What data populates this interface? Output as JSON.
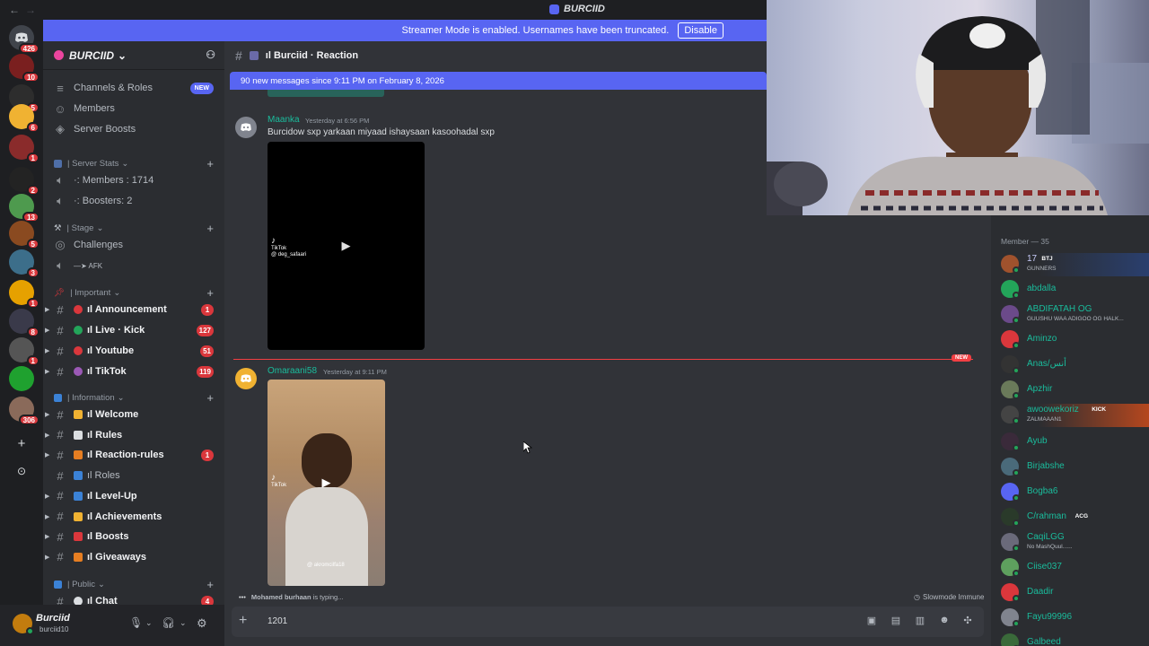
{
  "titlebar": {
    "title": "BURCIID",
    "back": "←",
    "forward": "→"
  },
  "banner": {
    "text": "Streamer Mode is enabled. Usernames have been truncated.",
    "button": "Disable"
  },
  "servers": [
    {
      "badge": "426",
      "color": "#40444b"
    },
    {
      "badge": "10",
      "color": "#7a1f1f"
    },
    {
      "badge": "5",
      "color": "#2d2d2d"
    },
    {
      "badge": "6",
      "color": "#f0b232"
    },
    {
      "badge": "1",
      "color": "#8a2b2b"
    },
    {
      "badge": "2",
      "color": "#232323"
    },
    {
      "badge": "13",
      "color": "#4e9a4e"
    },
    {
      "badge": "5",
      "color": "#8a4a20"
    },
    {
      "badge": "3",
      "color": "#3c6e8a"
    },
    {
      "badge": "1",
      "color": "#e6a100"
    },
    {
      "badge": "8",
      "color": "#3a3a4a"
    },
    {
      "badge": "1",
      "color": "#555"
    },
    {
      "badge": "",
      "color": "#1fa12f"
    },
    {
      "badge": "306",
      "color": "#8a6a5a"
    }
  ],
  "rail": {
    "add": "+",
    "discover": "⊙"
  },
  "server_name": "BURCIID",
  "sidebar": {
    "top_items": [
      {
        "label": "Channels & Roles",
        "badge": "NEW",
        "icon": "≡"
      },
      {
        "label": "Members",
        "icon": "☺"
      },
      {
        "label": "Server Boosts",
        "icon": "◈"
      }
    ],
    "cat_stats": "| Server Stats",
    "stats": [
      {
        "label": "·: Members : 1714"
      },
      {
        "label": "·: Boosters: 2"
      }
    ],
    "cat_stage": "| Stage",
    "stage": [
      {
        "label": "Challenges"
      },
      {
        "label": "—➤ AFK"
      }
    ],
    "cat_important": "| Important",
    "important": [
      {
        "label": "ıl Announcement",
        "badge": "1"
      },
      {
        "label": "ıl Live · Kick",
        "badge": "127"
      },
      {
        "label": "ıl Youtube",
        "badge": "51"
      },
      {
        "label": "ıl TikTok",
        "badge": "119"
      }
    ],
    "cat_info": "| Information",
    "info": [
      {
        "label": "ıl Welcome",
        "badge": "",
        "bold": true
      },
      {
        "label": "ıl Rules",
        "badge": "",
        "bold": true
      },
      {
        "label": "ıl Reaction-rules",
        "badge": "1",
        "bold": true
      },
      {
        "label": "ıl Roles",
        "badge": "",
        "bold": false
      },
      {
        "label": "ıl Level-Up",
        "badge": "",
        "bold": true
      },
      {
        "label": "ıl Achievements",
        "badge": "",
        "bold": true
      },
      {
        "label": "ıl Boosts",
        "badge": "",
        "bold": true
      },
      {
        "label": "ıl Giveaways",
        "badge": "",
        "bold": true
      }
    ],
    "cat_public": "| Public",
    "public": [
      {
        "label": "ıl Chat",
        "badge": "4"
      }
    ]
  },
  "user": {
    "name": "Burciid",
    "tag": "burciid10"
  },
  "chat": {
    "channel": "ıl Burciid · Reaction",
    "new_messages": "90 new messages since 9:11 PM on February 8, 2026",
    "messages": [
      {
        "author": "Maanka",
        "time": "Yesterday at 6:56 PM",
        "text": "Burcidow sxp yarkaan miyaad ishaysaan kasoohadal sxp"
      },
      {
        "author": "Omaraani58",
        "time": "Yesterday at 9:11 PM",
        "text": ""
      }
    ],
    "new_tag": "NEW",
    "tiktok_label": "TikTok",
    "tiktok_handle_1": "@ deg_safaari",
    "tiktok_handle_2": "@ akromcilfa18",
    "typing_user": "Mohamed burhaan",
    "typing_suffix": " is typing...",
    "slowmode": "Slowmode Immune",
    "composer_value": "1201"
  },
  "members": {
    "header": "Member — 35",
    "list": [
      {
        "name": "17",
        "sub": "GUNNERS",
        "tag": "BTJ",
        "color": "#c9cdfb",
        "av": "#a0522d",
        "status": "#23a55a"
      },
      {
        "name": "abdalla",
        "sub": "",
        "tag": "",
        "color": "#1abc9c",
        "av": "#23a55a",
        "status": "#23a55a"
      },
      {
        "name": "ABDIFATAH OG",
        "sub": "GUUSHU WAA ADIGOO OG HALK...",
        "tag": "",
        "color": "#1abc9c",
        "av": "#6b4a8a",
        "status": "#23a55a"
      },
      {
        "name": "Aminzo",
        "sub": "",
        "tag": "",
        "color": "#1abc9c",
        "av": "#da373c",
        "status": "#23a55a"
      },
      {
        "name": "Anas/أنس",
        "sub": "",
        "tag": "",
        "color": "#1abc9c",
        "av": "#333",
        "status": "#23a55a"
      },
      {
        "name": "Apzhir",
        "sub": "",
        "tag": "",
        "color": "#1abc9c",
        "av": "#6a7a5a",
        "status": "#23a55a"
      },
      {
        "name": "awoowekoriz",
        "sub": "ZALMAAAN1",
        "tag": "KICK",
        "color": "#1abc9c",
        "av": "#444",
        "status": "#23a55a"
      },
      {
        "name": "Ayub",
        "sub": "",
        "tag": "",
        "color": "#1abc9c",
        "av": "#3a2a3a",
        "status": "#23a55a"
      },
      {
        "name": "Birjabshe",
        "sub": "",
        "tag": "",
        "color": "#1abc9c",
        "av": "#4a6a7a",
        "status": "#23a55a"
      },
      {
        "name": "Bogba6",
        "sub": "",
        "tag": "",
        "color": "#1abc9c",
        "av": "#5865f2",
        "status": "#23a55a"
      },
      {
        "name": "C/rahman",
        "sub": "",
        "tag": "ACG",
        "color": "#1abc9c",
        "av": "#2a3a2a",
        "status": "#23a55a"
      },
      {
        "name": "CaqiLGG",
        "sub": "No MashQuul......",
        "tag": "",
        "color": "#1abc9c",
        "av": "#6a6a7a",
        "status": "#23a55a"
      },
      {
        "name": "Ciise037",
        "sub": "",
        "tag": "",
        "color": "#1abc9c",
        "av": "#5ea05e",
        "status": "#23a55a"
      },
      {
        "name": "Daadir",
        "sub": "",
        "tag": "",
        "color": "#1abc9c",
        "av": "#da373c",
        "status": "#23a55a"
      },
      {
        "name": "Fayu99996",
        "sub": "",
        "tag": "",
        "color": "#1abc9c",
        "av": "#80848e",
        "status": "#23a55a"
      },
      {
        "name": "Galbeed",
        "sub": "",
        "tag": "",
        "color": "#1abc9c",
        "av": "#3a6a3a",
        "status": "#23a55a"
      }
    ]
  }
}
